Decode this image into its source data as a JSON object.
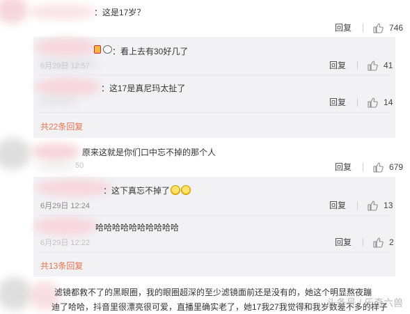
{
  "reply_label": "回复",
  "comments": [
    {
      "text": "：这是17岁？",
      "likes": "746",
      "replies": [
        {
          "text": "：看上去有30好几了",
          "time_visible": "6月29日 12:57",
          "likes": "41"
        },
        {
          "text": "：这17是真尼玛太扯了",
          "time_visible": "",
          "likes": "14"
        }
      ],
      "more_link": "共22条回复"
    },
    {
      "text": "原来这就是你们口中忘不掉的那个人",
      "time_partial": "50",
      "likes": "679",
      "replies": [
        {
          "text": "：这下真忘不掉了",
          "time": "6月29日 12:24",
          "likes": "13"
        },
        {
          "text": "哈哈哈哈哈哈哈哈哈哈",
          "time_visible": "6月29日 12:22",
          "likes": "2"
        }
      ],
      "more_link": "共13条回复"
    },
    {
      "text_line1": "滤镜都救不了的黑眼圈，我的眼圈超深的至少滤镜面前还是没有的，她这个明显熬夜蹦",
      "text_line2": "迪了哈哈，抖音里很漂亮很可爱，直播里确实老了，她17我27我觉得和我岁数差不多的样子"
    }
  ],
  "watermark": "头条号 / 乐奇六兽"
}
